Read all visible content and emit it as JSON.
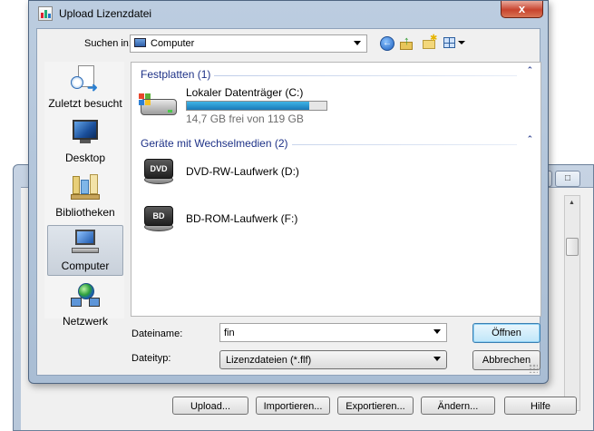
{
  "background_window": {
    "buttons": [
      {
        "label": "Upload..."
      },
      {
        "label": "Importieren..."
      },
      {
        "label": "Exportieren..."
      },
      {
        "label": "Ändern..."
      },
      {
        "label": "Hilfe"
      }
    ]
  },
  "dialog": {
    "title": "Upload Lizenzdatei",
    "close_glyph": "x",
    "toolbar": {
      "look_in_label": "Suchen in:",
      "look_in_value": "Computer",
      "icons": [
        "back-icon",
        "up-folder-icon",
        "new-folder-icon",
        "views-menu-icon"
      ]
    },
    "places": [
      {
        "label": "Zuletzt besucht",
        "icon": "recent-places-icon"
      },
      {
        "label": "Desktop",
        "icon": "desktop-icon"
      },
      {
        "label": "Bibliotheken",
        "icon": "libraries-icon"
      },
      {
        "label": "Computer",
        "icon": "computer-icon",
        "selected": true
      },
      {
        "label": "Netzwerk",
        "icon": "network-icon"
      }
    ],
    "groups": [
      {
        "header": "Festplatten (1)",
        "items": [
          {
            "name": "Lokaler Datenträger (C:)",
            "free_text": "14,7 GB frei von 119 GB",
            "used_fraction": 0.876,
            "icon": "hard-drive-icon"
          }
        ]
      },
      {
        "header": "Geräte mit Wechselmedien (2)",
        "items": [
          {
            "name": "DVD-RW-Laufwerk (D:)",
            "badge": "DVD",
            "icon": "dvd-drive-icon"
          },
          {
            "name": "BD-ROM-Laufwerk (F:)",
            "badge": "BD",
            "icon": "bd-drive-icon"
          }
        ]
      }
    ],
    "filename_label": "Dateiname:",
    "filename_value": "fin",
    "filetype_label": "Dateityp:",
    "filetype_value": "Lizenzdateien (*.flf)",
    "open_button": "Öffnen",
    "cancel_button": "Abbrechen"
  }
}
